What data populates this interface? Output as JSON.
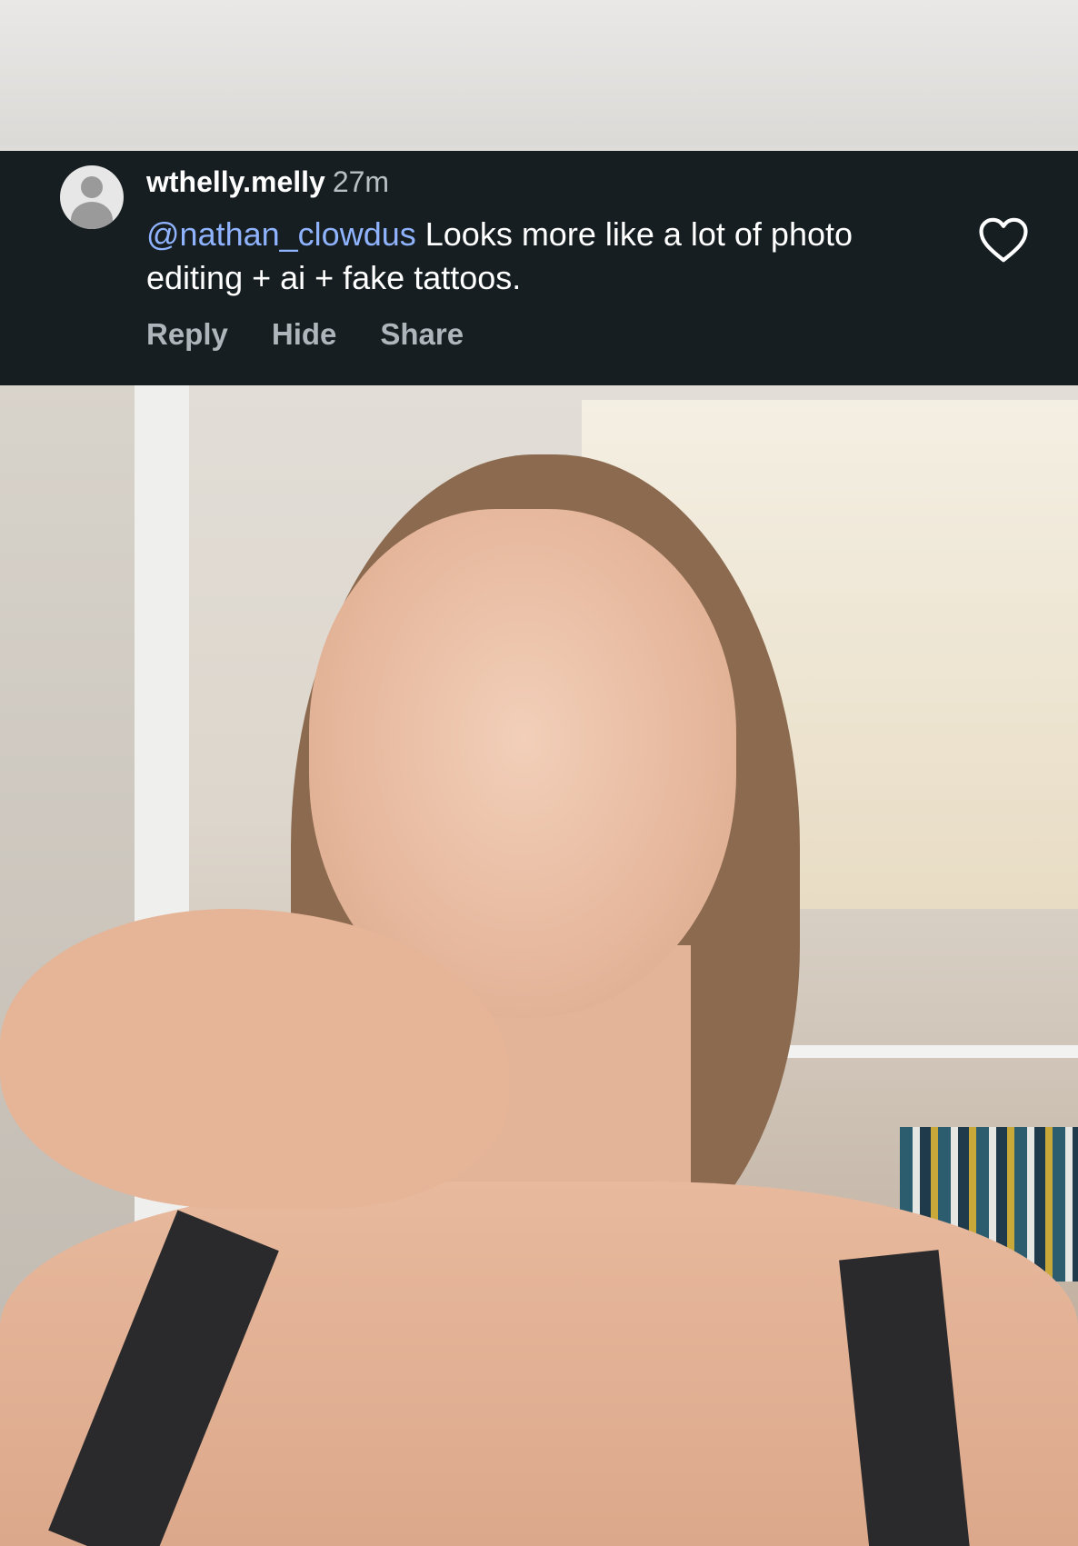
{
  "comment": {
    "username": "wthelly.melly",
    "timestamp": "27m",
    "mention": "@nathan_clowdus",
    "text": " Looks more like a lot of photo editing + ai + fake tattoos.",
    "actions": {
      "reply": "Reply",
      "hide": "Hide",
      "share": "Share"
    },
    "avatar_icon": "default-user-avatar",
    "like_icon": "heart-outline-icon"
  },
  "colors": {
    "overlay_bg": "#161e21",
    "mention": "#8fb3ff",
    "secondary_text": "#aeb6bc"
  }
}
